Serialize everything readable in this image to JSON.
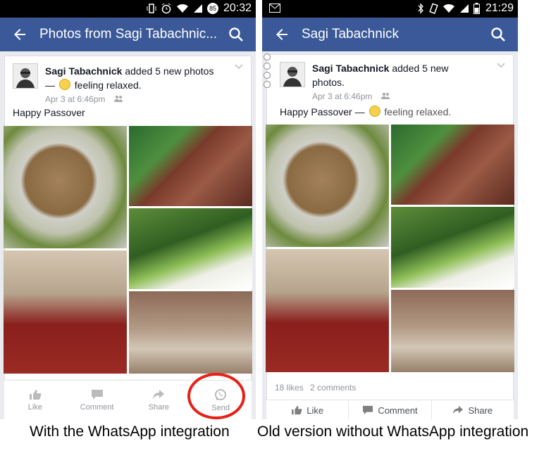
{
  "left_phone": {
    "status": {
      "time": "20:32",
      "battery": "85"
    },
    "appbar": {
      "title": "Photos from Sagi Tabachnic..."
    },
    "post": {
      "author": "Sagi Tabachnick",
      "action": " added 5 new photos — ",
      "feeling": "feeling relaxed.",
      "date": "Apr 3 at 6:46pm",
      "caption": "Happy Passover"
    },
    "actions": [
      {
        "label": "Like",
        "icon": "thumbs-up-icon"
      },
      {
        "label": "Comment",
        "icon": "comment-icon"
      },
      {
        "label": "Share",
        "icon": "share-icon"
      },
      {
        "label": "Send",
        "icon": "whatsapp-icon"
      }
    ]
  },
  "right_phone": {
    "status": {
      "time": "21:29"
    },
    "appbar": {
      "title": "Sagi Tabachnick"
    },
    "post": {
      "author": "Sagi Tabachnick",
      "action": " added 5 new photos.",
      "date": "Apr 3 at 6:46pm",
      "caption": "Happy Passover — ",
      "feeling": "feeling relaxed."
    },
    "stats": {
      "likes": "18 likes",
      "comments": "2 comments"
    },
    "actions": [
      {
        "label": "Like",
        "icon": "thumbs-up-icon"
      },
      {
        "label": "Comment",
        "icon": "comment-icon"
      },
      {
        "label": "Share",
        "icon": "share-icon"
      }
    ]
  },
  "labels": {
    "left": "With the WhatsApp integration",
    "right": "Old version without WhatsApp integration"
  },
  "colors": {
    "facebook_blue": "#3b5998",
    "highlight_red": "#e62117"
  }
}
